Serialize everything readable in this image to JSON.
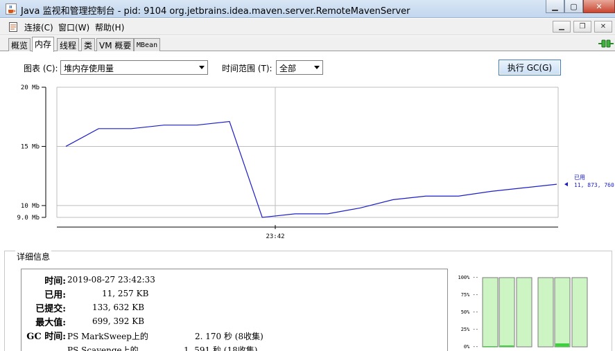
{
  "window": {
    "title": "Java 监视和管理控制台 - pid: 9104 org.jetbrains.idea.maven.server.RemoteMavenServer"
  },
  "menu": [
    {
      "label": "连接(C)"
    },
    {
      "label": "窗口(W)"
    },
    {
      "label": "帮助(H)"
    }
  ],
  "tabs": [
    {
      "label": "概览"
    },
    {
      "label": "内存"
    },
    {
      "label": "线程"
    },
    {
      "label": "类"
    },
    {
      "label": "VM 概要"
    },
    {
      "label": "MBean"
    }
  ],
  "controls": {
    "chart_label": "图表 (C):",
    "chart_value": "堆内存使用量",
    "range_label": "时间范围 (T):",
    "range_value": "全部",
    "gc_button": "执行 GC(G)"
  },
  "chart_data": {
    "type": "line",
    "y_unit": "Mb",
    "y_ticks": [
      "20 Mb",
      "15 Mb",
      "10 Mb",
      "9.0 Mb"
    ],
    "y_tick_values": [
      20,
      15,
      10,
      9.0
    ],
    "ylim": [
      9.0,
      20
    ],
    "x_tick": "23:42",
    "grid": true,
    "series": [
      {
        "name": "已用",
        "values": [
          15.0,
          16.5,
          16.5,
          16.8,
          16.8,
          17.1,
          9.0,
          9.3,
          9.3,
          9.8,
          10.5,
          10.8,
          10.8,
          11.2,
          11.5,
          11.8
        ]
      }
    ],
    "current_label": "已用",
    "current_value": "11, 873, 760"
  },
  "details": {
    "title": "详细信息",
    "rows": [
      {
        "key": "时间:",
        "value": "2019-08-27 23:42:33"
      },
      {
        "key": "已用:",
        "value": "11, 257 KB"
      },
      {
        "key": "已提交:",
        "value": "133, 632 KB"
      },
      {
        "key": "最大值:",
        "value": "699, 392 KB"
      },
      {
        "key": "GC 时间:",
        "value": "PS MarkSweep上的",
        "value2": "2. 170  秒 (8收集)"
      },
      {
        "key": "",
        "value": "PS Scavenge上的",
        "value2": "1. 591  秒 (18收集)"
      }
    ]
  },
  "pool_bars": {
    "ticks": [
      "100% --",
      "75% --",
      "50% --",
      "25% --",
      "0% --"
    ],
    "bars": [
      {
        "fill": 0.01,
        "selected": false
      },
      {
        "fill": 0.02,
        "selected": false
      },
      {
        "fill": 0.0,
        "selected": false
      },
      {
        "fill": 0.0,
        "selected": false
      },
      {
        "fill": 0.05,
        "selected": false
      },
      {
        "fill": 0.0,
        "selected": false
      }
    ]
  },
  "colors": {
    "line": "#1c1cc8",
    "bar_fill_light": "#cdf5c4",
    "bar_fill_used": "#3fd03f"
  }
}
